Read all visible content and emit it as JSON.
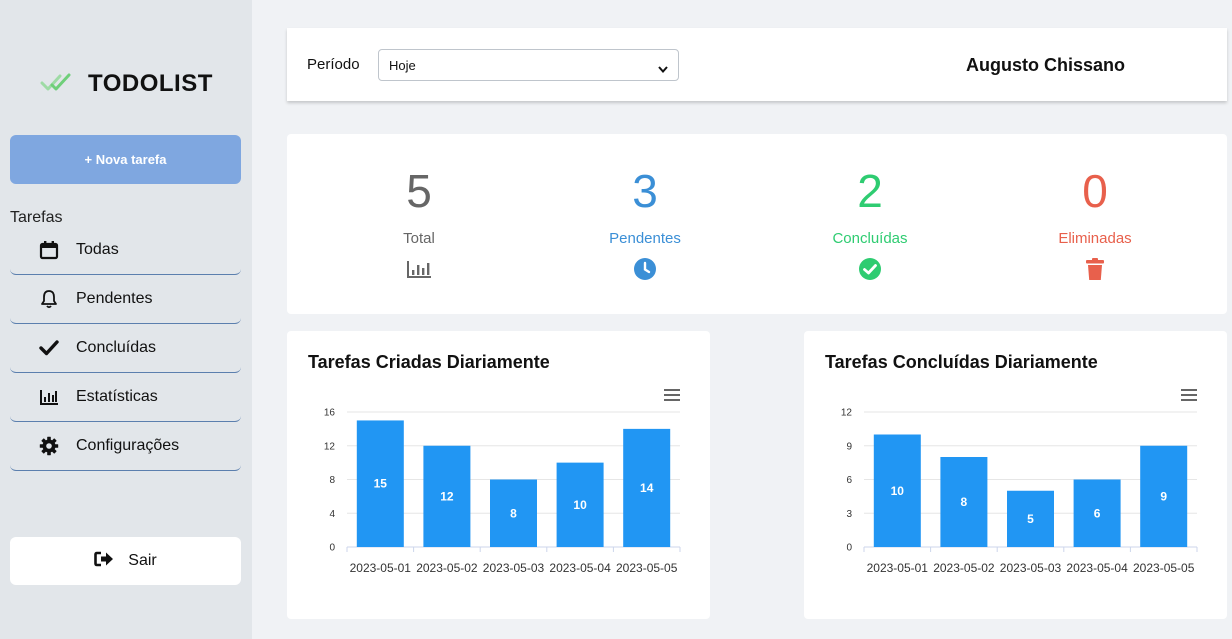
{
  "brand": {
    "title": "TODOLIST",
    "icon": "double-check-icon",
    "icon_color": "#6fcf7a"
  },
  "sidebar": {
    "new_task_label": "+ Nova tarefa",
    "section_label": "Tarefas",
    "items": [
      {
        "label": "Todas",
        "icon": "calendar-icon"
      },
      {
        "label": "Pendentes",
        "icon": "bell-icon"
      },
      {
        "label": "Concluídas",
        "icon": "check-icon"
      },
      {
        "label": "Estatísticas",
        "icon": "bar-chart-icon"
      },
      {
        "label": "Configurações",
        "icon": "gear-icon"
      }
    ],
    "logout_label": "Sair"
  },
  "header": {
    "period_label": "Período",
    "period_value": "Hoje",
    "user_name": "Augusto Chissano"
  },
  "stats": [
    {
      "value": "5",
      "label": "Total",
      "color": "#666666",
      "icon": "bar-chart-icon"
    },
    {
      "value": "3",
      "label": "Pendentes",
      "color": "#3b8fd6",
      "icon": "clock-icon"
    },
    {
      "value": "2",
      "label": "Concluídas",
      "color": "#2ecc71",
      "icon": "check-circle-icon"
    },
    {
      "value": "0",
      "label": "Eliminadas",
      "color": "#e8604c",
      "icon": "trash-icon"
    }
  ],
  "chart_data": [
    {
      "type": "bar",
      "title": "Tarefas Criadas Diariamente",
      "categories": [
        "2023-05-01",
        "2023-05-02",
        "2023-05-03",
        "2023-05-04",
        "2023-05-05"
      ],
      "values": [
        15,
        12,
        8,
        10,
        14
      ],
      "yticks": [
        0,
        4,
        8,
        12,
        16
      ],
      "ylim": [
        0,
        16
      ],
      "color": "#2196f3",
      "grid": true
    },
    {
      "type": "bar",
      "title": "Tarefas Concluídas Diariamente",
      "categories": [
        "2023-05-01",
        "2023-05-02",
        "2023-05-03",
        "2023-05-04",
        "2023-05-05"
      ],
      "values": [
        10,
        8,
        5,
        6,
        9
      ],
      "yticks": [
        0,
        3,
        6,
        9,
        12
      ],
      "ylim": [
        0,
        12
      ],
      "color": "#2196f3",
      "grid": true
    }
  ]
}
